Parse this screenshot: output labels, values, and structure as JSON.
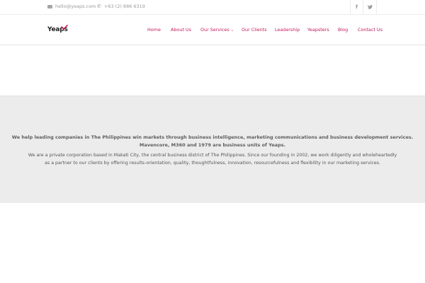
{
  "topbar": {
    "email": "hello@yeaps.com",
    "phone": "+63 (2) 886 6319",
    "social": [
      {
        "icon": "facebook-icon",
        "glyph": "f"
      },
      {
        "icon": "twitter-icon",
        "glyph": "🐦"
      }
    ]
  },
  "header": {
    "logo_text": "Yeaps",
    "accent_color": "#c2185b",
    "nav": [
      {
        "label": "Home"
      },
      {
        "label": "About Us"
      },
      {
        "label": "Our Services",
        "has_dropdown": true
      },
      {
        "label": "Our Clients"
      },
      {
        "label": "Leadership"
      },
      {
        "label": "Yeapsters"
      },
      {
        "label": "Blog"
      },
      {
        "label": "Contact Us"
      }
    ]
  },
  "intro": {
    "lead_line1": "We help leading companies in The Philippines win markets through business intelligence, marketing communications and business development services.",
    "lead_line2": "Mavencore, M360 and 1979 are business units of Yeaps.",
    "body_line1": "We are a private corporation based in Makati City, the central business district of The Philippines. Since our founding in 2002, we work diligently and wholeheartedly",
    "body_line2": "as a partner to our clients by offering results-orientation, quality, thoughtfulness, innovation, resourcefulness and flexibility in our marketing services."
  }
}
